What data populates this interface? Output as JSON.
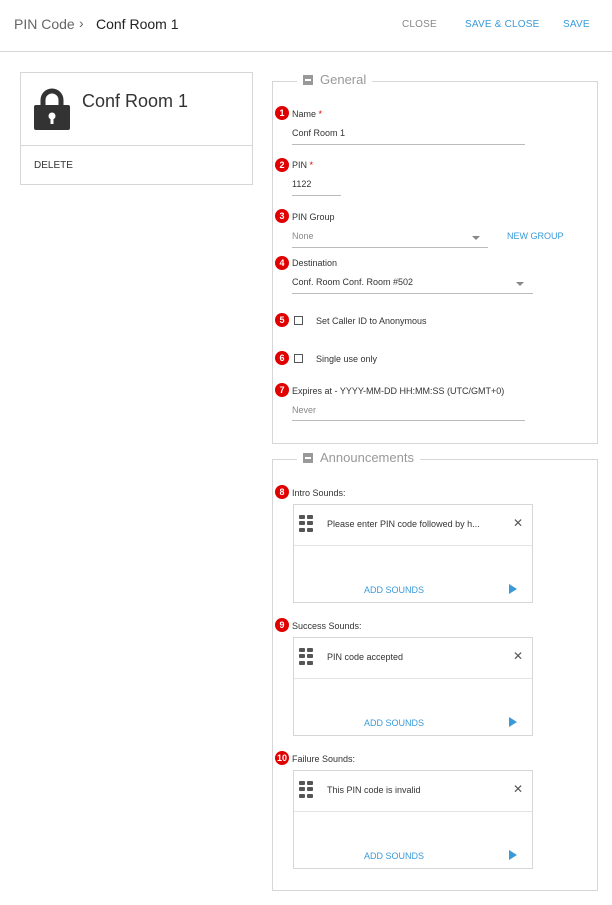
{
  "breadcrumb": {
    "root": "PIN Code",
    "separator": "›",
    "current": "Conf Room 1"
  },
  "header_actions": {
    "close": "CLOSE",
    "save_close": "SAVE & CLOSE",
    "save": "SAVE"
  },
  "card": {
    "title": "Conf Room 1",
    "delete": "DELETE",
    "icon": "lock-icon"
  },
  "general": {
    "legend": "General",
    "name": {
      "badge": "1",
      "label": "Name",
      "required": "*",
      "value": "Conf Room 1"
    },
    "pin": {
      "badge": "2",
      "label": "PIN",
      "required": "*",
      "value": "1122"
    },
    "pin_group": {
      "badge": "3",
      "label": "PIN Group",
      "value": "None",
      "new_group": "NEW GROUP"
    },
    "destination": {
      "badge": "4",
      "label": "Destination",
      "value": "Conf. Room Conf. Room #502"
    },
    "anonymous": {
      "badge": "5",
      "label": "Set Caller ID to Anonymous",
      "checked": false
    },
    "single_use": {
      "badge": "6",
      "label": "Single use only",
      "checked": false
    },
    "expires": {
      "badge": "7",
      "label": "Expires at - YYYY-MM-DD HH:MM:SS (UTC/GMT+0)",
      "placeholder": "Never"
    }
  },
  "announcements": {
    "legend": "Announcements",
    "intro": {
      "badge": "8",
      "label": "Intro Sounds:",
      "sound": "Please enter PIN code followed by h...",
      "add": "ADD SOUNDS"
    },
    "success": {
      "badge": "9",
      "label": "Success Sounds:",
      "sound": "PIN code accepted",
      "add": "ADD SOUNDS"
    },
    "failure": {
      "badge": "10",
      "label": "Failure Sounds:",
      "sound": "This PIN code is invalid",
      "add": "ADD SOUNDS"
    }
  },
  "colors": {
    "accent": "#3a9ad9",
    "badge": "#e00000",
    "border": "#d6d6d6"
  }
}
